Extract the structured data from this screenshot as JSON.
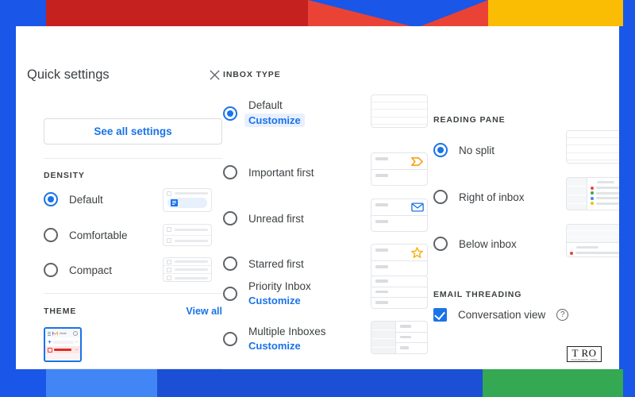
{
  "backdrop": {
    "colors": {
      "blue": "#1a56e8",
      "dark_red": "#c5221f",
      "red": "#ea4335",
      "yellow": "#fbbc04",
      "green": "#34a853",
      "light_blue": "#4285f4"
    }
  },
  "theme_colors": {
    "accent_blue": "#1a73e8",
    "text_primary": "#3c4043",
    "text_secondary": "#5f6368",
    "divider": "#e8eaed",
    "highlight_bg": "#e8f0fe"
  },
  "header": {
    "title": "Quick settings",
    "close_icon": "close-icon",
    "see_all_settings": "See all settings"
  },
  "density": {
    "label": "DENSITY",
    "options": [
      {
        "label": "Default",
        "selected": true
      },
      {
        "label": "Comfortable",
        "selected": false
      },
      {
        "label": "Compact",
        "selected": false
      }
    ]
  },
  "theme": {
    "label": "THEME",
    "view_all": "View all",
    "thumbnail_name": "gmail-theme-thumbnail",
    "thumbnail_label": "Gmail"
  },
  "inbox_type": {
    "label": "INBOX TYPE",
    "options": [
      {
        "label": "Default",
        "selected": true,
        "customize": "Customize",
        "customize_highlighted": true,
        "preview": "rows"
      },
      {
        "label": "Important first",
        "selected": false,
        "customize": null,
        "customize_highlighted": false,
        "preview": "split-important"
      },
      {
        "label": "Unread first",
        "selected": false,
        "customize": null,
        "customize_highlighted": false,
        "preview": "split-unread"
      },
      {
        "label": "Starred first",
        "selected": false,
        "customize": null,
        "customize_highlighted": false,
        "preview": "split-starred"
      },
      {
        "label": "Priority Inbox",
        "selected": false,
        "customize": "Customize",
        "customize_highlighted": false,
        "preview": "three-section"
      },
      {
        "label": "Multiple Inboxes",
        "selected": false,
        "customize": "Customize",
        "customize_highlighted": false,
        "preview": "multi-column"
      }
    ]
  },
  "reading_pane": {
    "label": "READING PANE",
    "options": [
      {
        "label": "No split",
        "selected": true,
        "preview": "rows"
      },
      {
        "label": "Right of inbox",
        "selected": false,
        "preview": "right-split"
      },
      {
        "label": "Below inbox",
        "selected": false,
        "preview": "below-split"
      }
    ],
    "dot_colors": [
      "#ea4335",
      "#34a853",
      "#4285f4",
      "#fbbc04"
    ]
  },
  "email_threading": {
    "label": "EMAIL THREADING",
    "conversation_view": {
      "label": "Conversation view",
      "checked": true,
      "help_icon": "help-circle-icon",
      "help_glyph": "?"
    }
  },
  "watermark": {
    "main": "T RO",
    "sub": "Tools Research - online"
  }
}
